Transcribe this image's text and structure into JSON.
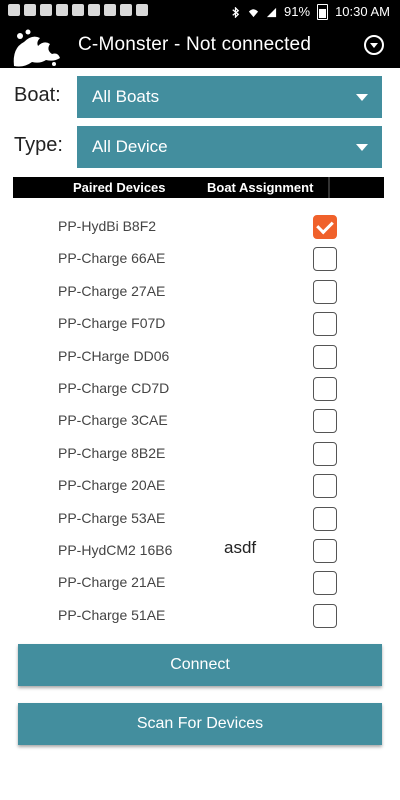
{
  "status_bar": {
    "notification_icons": [
      "facebook-icon",
      "messenger-icon",
      "gmail-icon",
      "gmail-icon",
      "game-icon",
      "gmail-icon",
      "image-icon",
      "gmail-icon",
      "warning-icon"
    ],
    "battery": "91%",
    "time": "10:30 AM"
  },
  "app_bar": {
    "title": "C-Monster - Not connected",
    "logo_icon": "octopus-logo-icon",
    "menu_icon": "dropdown-circle-icon"
  },
  "filters": {
    "boat_label": "Boat:",
    "boat_value": "All Boats",
    "type_label": "Type:",
    "type_value": "All Device"
  },
  "tabs": {
    "paired": "Paired Devices",
    "boat": "Boat Assignment"
  },
  "devices": [
    {
      "name": "PP-HydBi B8F2",
      "assignment": "",
      "checked": true
    },
    {
      "name": "PP-Charge 66AE",
      "assignment": "",
      "checked": false
    },
    {
      "name": "PP-Charge 27AE",
      "assignment": "",
      "checked": false
    },
    {
      "name": "PP-Charge F07D",
      "assignment": "",
      "checked": false
    },
    {
      "name": "PP-CHarge DD06",
      "assignment": "",
      "checked": false
    },
    {
      "name": "PP-Charge CD7D",
      "assignment": "",
      "checked": false
    },
    {
      "name": "PP-Charge 3CAE",
      "assignment": "",
      "checked": false
    },
    {
      "name": "PP-Charge 8B2E",
      "assignment": "",
      "checked": false
    },
    {
      "name": "PP-Charge 20AE",
      "assignment": "",
      "checked": false
    },
    {
      "name": "PP-Charge 53AE",
      "assignment": "",
      "checked": false
    },
    {
      "name": "PP-HydCM2 16B6",
      "assignment": "asdf",
      "checked": false
    },
    {
      "name": "PP-Charge 21AE",
      "assignment": "",
      "checked": false
    },
    {
      "name": "PP-Charge 51AE",
      "assignment": "",
      "checked": false
    }
  ],
  "buttons": {
    "connect": "Connect",
    "scan": "Scan For Devices"
  },
  "colors": {
    "accent": "#438e9e",
    "checked": "#f0612b"
  }
}
